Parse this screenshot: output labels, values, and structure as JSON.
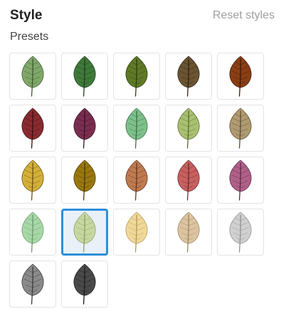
{
  "header": {
    "title": "Style",
    "reset_label": "Reset styles"
  },
  "presets_label": "Presets",
  "presets": [
    {
      "fill": "#7fa86a",
      "vein": "#3d5a2e",
      "selected": false
    },
    {
      "fill": "#3f7a3a",
      "vein": "#1d3d1a",
      "selected": false
    },
    {
      "fill": "#5f7a26",
      "vein": "#2d3d10",
      "selected": false
    },
    {
      "fill": "#6a5432",
      "vein": "#2e2210",
      "selected": false
    },
    {
      "fill": "#8a3e14",
      "vein": "#3e1a05",
      "selected": false
    },
    {
      "fill": "#8a2a30",
      "vein": "#3a0f12",
      "selected": false
    },
    {
      "fill": "#7a2e50",
      "vein": "#3a1024",
      "selected": false
    },
    {
      "fill": "#7cc08a",
      "vein": "#3f6a48",
      "selected": false
    },
    {
      "fill": "#a8c070",
      "vein": "#586a36",
      "selected": false
    },
    {
      "fill": "#b09a70",
      "vein": "#5a4c32",
      "selected": false
    },
    {
      "fill": "#d4b03a",
      "vein": "#6a5210",
      "selected": false
    },
    {
      "fill": "#9a7810",
      "vein": "#4a3a05",
      "selected": false
    },
    {
      "fill": "#c07a50",
      "vein": "#603820",
      "selected": false
    },
    {
      "fill": "#c86060",
      "vein": "#6a2a2a",
      "selected": false
    },
    {
      "fill": "#b06088",
      "vein": "#5a2a44",
      "selected": false
    },
    {
      "fill": "#a8d8a8",
      "vein": "#6a9a6a",
      "selected": false
    },
    {
      "fill": "#c8d8a0",
      "vein": "#8aa06a",
      "selected": true
    },
    {
      "fill": "#f0d898",
      "vein": "#b09a5a",
      "selected": false
    },
    {
      "fill": "#dcc4a0",
      "vein": "#9a8460",
      "selected": false
    },
    {
      "fill": "#d0d0d0",
      "vein": "#909090",
      "selected": false
    },
    {
      "fill": "#8a8a8a",
      "vein": "#3a3a3a",
      "selected": false
    },
    {
      "fill": "#4a4a4a",
      "vein": "#1a1a1a",
      "selected": false
    }
  ]
}
